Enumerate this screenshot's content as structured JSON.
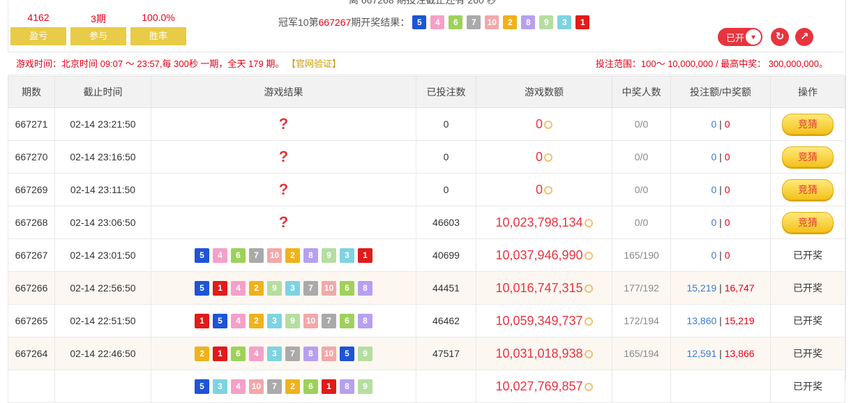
{
  "header": {
    "top_line": "离 667268 期投注截止还有 260 秒",
    "stats": [
      {
        "value": "4162",
        "label": "盈亏"
      },
      {
        "value": "3期",
        "label": "参与"
      },
      {
        "value": "100.0%",
        "label": "胜率"
      }
    ],
    "last_result_prefix": "冠军10第",
    "last_result_issue": "667267",
    "last_result_suffix": "期开奖结果：",
    "last_result_balls": [
      5,
      4,
      6,
      7,
      10,
      2,
      8,
      9,
      3,
      1
    ],
    "toggle_label": "已开",
    "refresh_icon": "refresh-icon",
    "trend_icon": "trend-icon"
  },
  "info": {
    "game_time": "游戏时间：北京时间 09:07 ～ 23:57,每 300秒 一期，全天 179 期。",
    "verify": "【官网验证】",
    "bet_range": "投注范围：100～ 10,000,000 / 最高中奖： 300,000,000。"
  },
  "table": {
    "headers": [
      "期数",
      "截止时间",
      "游戏结果",
      "已投注数",
      "游戏数额",
      "中奖人数",
      "投注额/中奖额",
      "操作"
    ],
    "rows": [
      {
        "issue": "667271",
        "time": "02-14 23:21:50",
        "result": "?",
        "balls": [],
        "bets": "0",
        "amount": "0",
        "winners": "0/0",
        "bet_amt": "0",
        "win_amt": "0",
        "action": "竞猜",
        "open": true
      },
      {
        "issue": "667270",
        "time": "02-14 23:16:50",
        "result": "?",
        "balls": [],
        "bets": "0",
        "amount": "0",
        "winners": "0/0",
        "bet_amt": "0",
        "win_amt": "0",
        "action": "竞猜",
        "open": true
      },
      {
        "issue": "667269",
        "time": "02-14 23:11:50",
        "result": "?",
        "balls": [],
        "bets": "0",
        "amount": "0",
        "winners": "0/0",
        "bet_amt": "0",
        "win_amt": "0",
        "action": "竞猜",
        "open": true
      },
      {
        "issue": "667268",
        "time": "02-14 23:06:50",
        "result": "?",
        "balls": [],
        "bets": "46603",
        "amount": "10,023,798,134",
        "winners": "0/0",
        "bet_amt": "0",
        "win_amt": "0",
        "action": "竞猜",
        "open": true
      },
      {
        "issue": "667267",
        "time": "02-14 23:01:50",
        "result": "",
        "balls": [
          5,
          4,
          6,
          7,
          10,
          2,
          8,
          9,
          3,
          1
        ],
        "bets": "40699",
        "amount": "10,037,946,990",
        "winners": "165/190",
        "bet_amt": "0",
        "win_amt": "0",
        "action": "已开奖",
        "open": false
      },
      {
        "issue": "667266",
        "time": "02-14 22:56:50",
        "result": "",
        "balls": [
          5,
          1,
          4,
          2,
          9,
          3,
          7,
          10,
          6,
          8
        ],
        "bets": "44451",
        "amount": "10,016,747,315",
        "winners": "177/192",
        "bet_amt": "15,219",
        "win_amt": "16,747",
        "action": "已开奖",
        "open": false
      },
      {
        "issue": "667265",
        "time": "02-14 22:51:50",
        "result": "",
        "balls": [
          1,
          5,
          4,
          2,
          3,
          9,
          10,
          7,
          6,
          8
        ],
        "bets": "46462",
        "amount": "10,059,349,737",
        "winners": "172/194",
        "bet_amt": "13,860",
        "win_amt": "15,219",
        "action": "已开奖",
        "open": false
      },
      {
        "issue": "667264",
        "time": "02-14 22:46:50",
        "result": "",
        "balls": [
          2,
          1,
          6,
          4,
          3,
          7,
          8,
          10,
          5,
          9
        ],
        "bets": "47517",
        "amount": "10,031,018,938",
        "winners": "165/194",
        "bet_amt": "12,591",
        "win_amt": "13,866",
        "action": "已开奖",
        "open": false
      },
      {
        "issue": "",
        "time": "",
        "result": "",
        "balls": [
          5,
          3,
          4,
          10,
          7,
          2,
          6,
          1,
          8,
          9
        ],
        "bets": "",
        "amount": "10,027,769,857",
        "winners": "",
        "bet_amt": "",
        "win_amt": "",
        "action": "已开奖",
        "open": false
      }
    ]
  }
}
